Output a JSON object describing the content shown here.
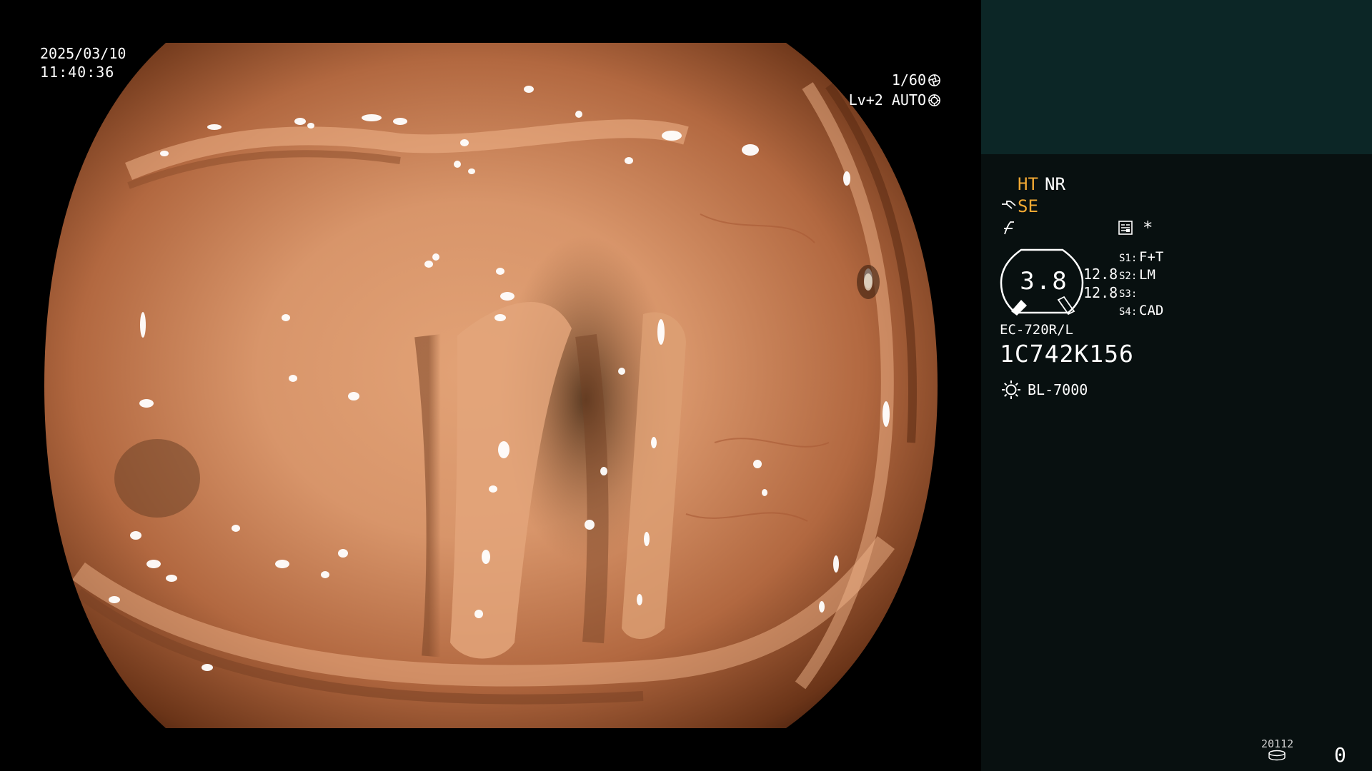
{
  "overlay": {
    "date": "2025/03/10",
    "time": "11:40:36",
    "shutter": "1/60",
    "shutter_icon": "aperture-icon",
    "exposure": "Lv+2 AUTO",
    "exposure_icon": "auto-iris-icon"
  },
  "panel": {
    "mode_ht": "HT",
    "mode_nr": "NR",
    "mode_se": "SE",
    "star": "*",
    "zoom": {
      "value": "3.8",
      "top_value": "12.8",
      "bottom_value": "12.8"
    },
    "scope_switches": [
      {
        "key": "S1:",
        "value": "F+T"
      },
      {
        "key": "S2:",
        "value": "LM"
      },
      {
        "key": "S3:",
        "value": ""
      },
      {
        "key": "S4:",
        "value": "CAD"
      }
    ],
    "scope_model": "EC-720R/L",
    "scope_serial": "1C742K156",
    "light_source": "BL-7000",
    "storage_count": "20112",
    "capture_count": "0"
  },
  "colors": {
    "panel_header": "#0c2626",
    "panel_body": "#081010",
    "active_mode": "#f2a933",
    "text": "#ffffff"
  }
}
